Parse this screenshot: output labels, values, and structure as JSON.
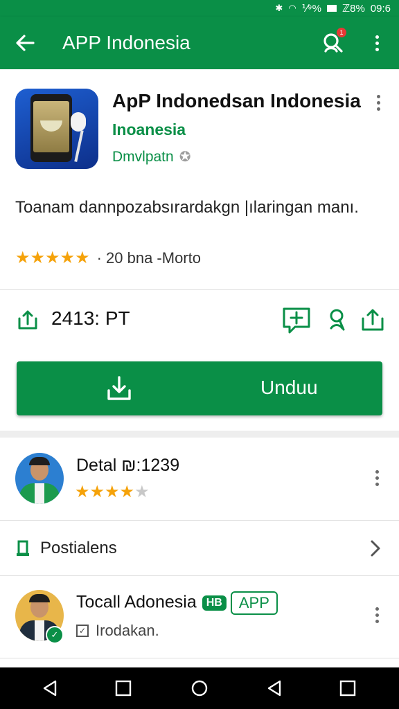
{
  "status_bar": {
    "signal_text": "⅟⁹%",
    "battery_text": "ℤ8%",
    "time": "09:6"
  },
  "app_bar": {
    "title": "APP Indonesia",
    "search_badge": "1"
  },
  "app": {
    "name": "ApP Indonedsan Indonesia",
    "developer": "Inoanesia",
    "subtitle": "Dmvlpatn",
    "description": "Toanam dannpozabsırardakgn |ılaringan manı.",
    "rating_text": "· 20 bna -Morto",
    "rating_stars": 5
  },
  "stats": {
    "size_text": "2413: PT"
  },
  "install": {
    "label": "Unduu"
  },
  "items": [
    {
      "title": "Detal ₪:1239",
      "rating_stars": 4.5
    }
  ],
  "section": {
    "label": "Postialens"
  },
  "item2": {
    "title": "Tocall Adonesia",
    "tag": "HB",
    "tag_outline": "APP",
    "subtitle": "Irodakan."
  },
  "colors": {
    "primary": "#0a8f47",
    "star": "#f5a20a"
  },
  "icons": [
    "back-arrow-icon",
    "search-icon",
    "overflow-icon",
    "share-icon",
    "add-comment-icon",
    "link-icon",
    "upload-icon",
    "download-icon",
    "bookmark-icon",
    "chevron-right-icon",
    "nav-back-icon",
    "nav-home-icon",
    "nav-recent-icon"
  ]
}
